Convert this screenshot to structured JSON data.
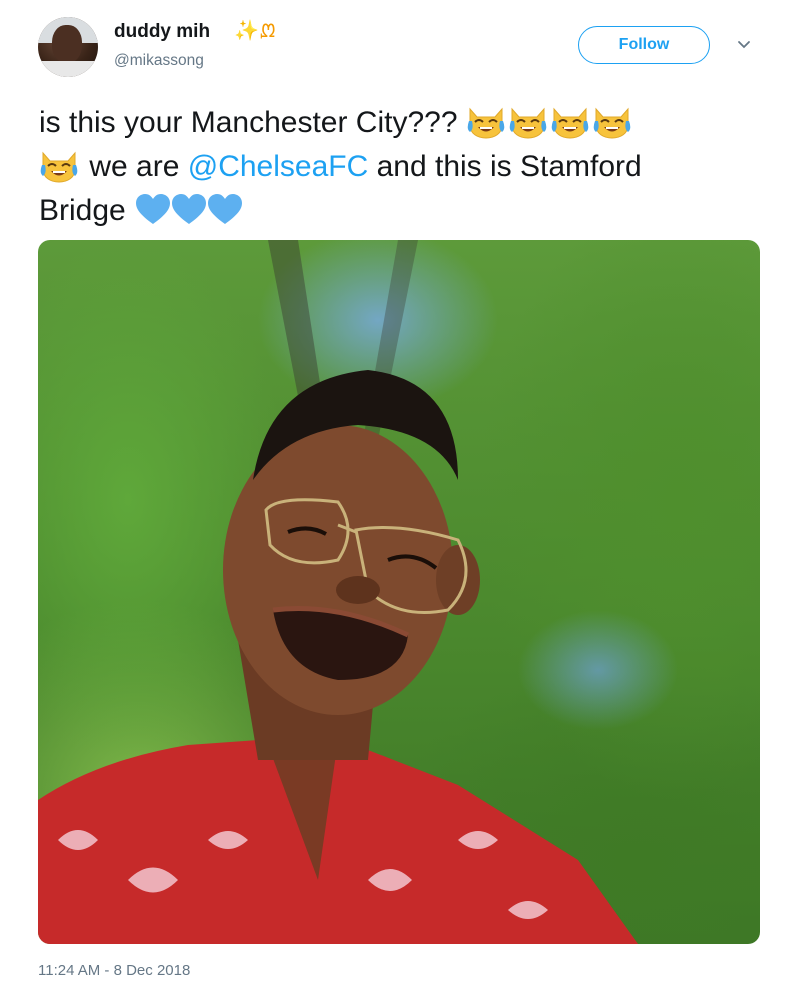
{
  "user": {
    "display_name": "duddy mih",
    "name_emoji": "✨",
    "name_symbol": "ᘻ",
    "handle": "@mikassong"
  },
  "actions": {
    "follow_label": "Follow"
  },
  "tweet": {
    "text_part1": "is this your Manchester City???",
    "text_part2": "we are",
    "mention": "@ChelseaFC",
    "text_part3": "and this is Stamford",
    "text_part4": "Bridge",
    "emoji_laughing": "joy-cat-icon",
    "emoji_heart": "blue-heart-icon",
    "colors": {
      "link": "#1da1f2",
      "heart": "#5db0f0",
      "text": "#14171a",
      "secondary": "#657786"
    }
  },
  "timestamp": "11:24 AM - 8 Dec 2018"
}
